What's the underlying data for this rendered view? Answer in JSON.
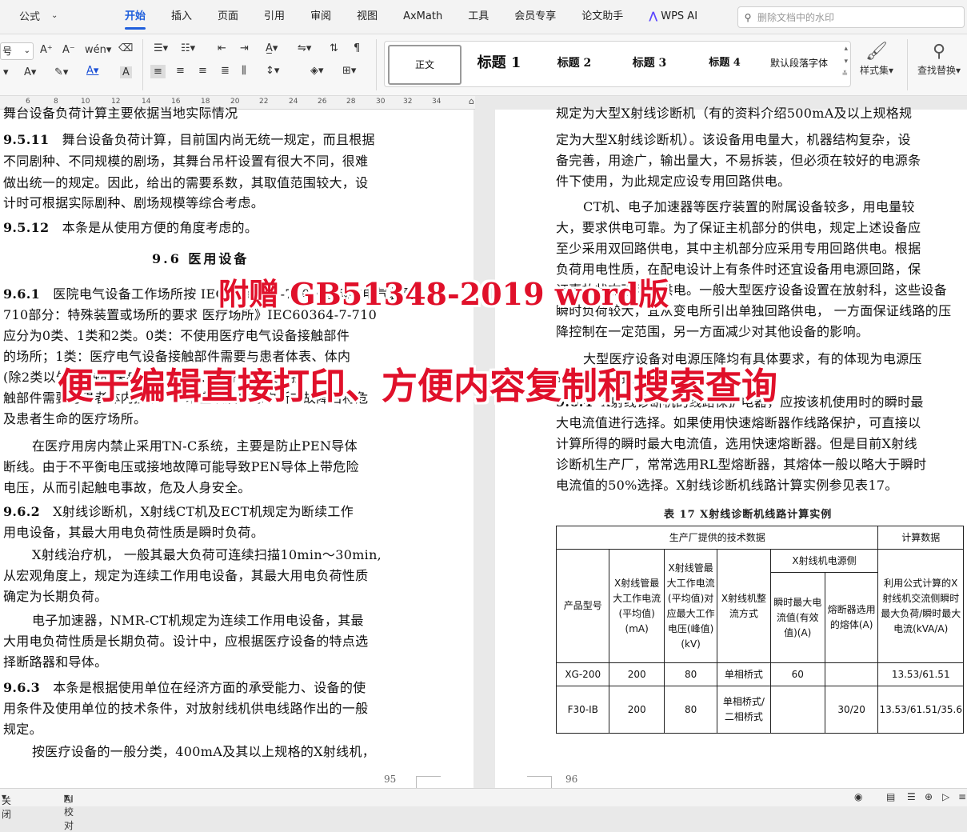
{
  "menubar": {
    "left_label": "公式",
    "tabs": [
      "开始",
      "插入",
      "页面",
      "引用",
      "审阅",
      "视图",
      "AxMath",
      "工具",
      "会员专享",
      "论文助手"
    ],
    "wps_ai": "WPS AI",
    "search_placeholder": "删除文档中的水印"
  },
  "ribbon": {
    "font_size": "号",
    "styles": [
      "正文",
      "标题 1",
      "标题 2",
      "标题 3",
      "标题 4",
      "默认段落字体"
    ],
    "styles_set": "样式集",
    "find_replace": "查找替换"
  },
  "ruler": [
    "6",
    "8",
    "10",
    "12",
    "14",
    "16",
    "18",
    "20",
    "22",
    "24",
    "26",
    "28",
    "30",
    "32",
    "34"
  ],
  "left_page": {
    "top_cut": "舞台设备负荷计算主要依据当地实际情况",
    "lines": [
      {
        "num": "9.5.11",
        "text": "舞台设备负荷计算，目前国内尚无统一规定，而且根据"
      },
      {
        "text": "不同剧种、不同规模的剧场，其舞台吊杆设置有很大不同，很难"
      },
      {
        "text": "做出统一的规定。因此，给出的需要系数，其取值范围较大，设"
      },
      {
        "text": "计时可根据实际剧种、剧场规模等综合考虑。"
      },
      {
        "num": "9.5.12",
        "text": "本条是从使用方便的角度考虑的。"
      }
    ],
    "heading": "9.6 医用设备",
    "lines2": [
      {
        "num": "9.6.1",
        "text": "医院电气设备工作场所按 IEC60364-7-710《建筑物电气装置"
      },
      {
        "text": "710部分：特殊装置或场所的要求 医疗场所》IEC60364-7-710"
      },
      {
        "text": "应分为0类、1类和2类。0类：不使用医疗电气设备接触部件"
      },
      {
        "text": "的场所；1类：医疗电气设备接触部件需要与患者体表、体内"
      },
      {
        "text": "(除2类以外)接触的医疗场所；2类：医疗电气设备接"
      },
      {
        "text": "触部件需要与患者体内接触，手术室以及电源中断或故障后将危"
      },
      {
        "text": "及患者生命的医疗场所。"
      },
      {
        "indent": true,
        "text": "在医疗用房内禁止采用TN-C系统，主要是防止PEN导体"
      },
      {
        "text": "断线。由于不平衡电压或接地故障可能导致PEN导体上带危险"
      },
      {
        "text": "电压，从而引起触电事故，危及人身安全。"
      },
      {
        "num": "9.6.2",
        "text": "X射线诊断机，X射线CT机及ECT机规定为断续工作"
      },
      {
        "text": "用电设备，其最大用电负荷性质是瞬时负荷。"
      },
      {
        "indent": true,
        "text": "X射线治疗机，  一般其最大负荷可连续扫描10min～30min,"
      },
      {
        "text": "从宏观角度上，规定为连续工作用电设备，其最大用电负荷性质"
      },
      {
        "text": "确定为长期负荷。"
      },
      {
        "indent": true,
        "text": "电子加速器，NMR-CT机规定为连续工作用电设备，其最"
      },
      {
        "text": "大用电负荷性质是长期负荷。设计中，应根据医疗设备的特点选"
      },
      {
        "text": "择断路器和导体。"
      },
      {
        "num": "9.6.3",
        "text": "本条是根据使用单位在经济方面的承受能力、设备的使"
      },
      {
        "text": "用条件及使用单位的技术条件，对放射线机供电线路作出的一般"
      },
      {
        "text": "规定。"
      },
      {
        "indent": true,
        "text": "按医疗设备的一般分类，400mA及其以上规格的X射线机，"
      }
    ],
    "page_number": "95"
  },
  "right_page": {
    "lines": [
      {
        "text": "规定为大型X射线诊断机（有的资料介绍500mA及以上规格规"
      },
      {
        "text": "定为大型X射线诊断机）。该设备用电量大，机器结构复杂，设"
      },
      {
        "text": "备完善，用途广，输出量大，不易拆装，但必须在较好的电源条"
      },
      {
        "text": "件下使用，为此规定应设专用回路供电。"
      },
      {
        "indent": true,
        "text": "CT机、电子加速器等医疗装置的附属设备较多，用电量较"
      },
      {
        "text": "大，要求供电可靠。为了保证主机部分的供电，规定上述设备应"
      },
      {
        "text": "至少采用双回路供电，其中主机部分应采用专用回路供电。根据"
      },
      {
        "text": "负荷用电性质，在配电设计上有条件时还宜设备用电源回路，保"
      },
      {
        "text": "证事故状态下可靠供电。一般大型医疗设备设置在放射科，这些设备"
      },
      {
        "text": "瞬时负荷较大，宜从变电所引出单独回路供电，  一方面保证线路的压"
      },
      {
        "text": "降控制在一定范围，另一方面减少对其他设备的影响。"
      },
      {
        "indent": true,
        "text": "大型医疗设备对电源压降均有具体要求，有的体现为电源压"
      },
      {
        "text": "降，有的体现为电源内阻。"
      },
      {
        "num": "9.6.4",
        "text": "X射线诊断机的线路保护电器，应按该机使用时的瞬时最"
      },
      {
        "text": "大电流值进行选择。如果使用快速熔断器作线路保护，可直接以"
      },
      {
        "text": "计算所得的瞬时最大电流值，选用快速熔断器。但是目前X射线"
      },
      {
        "text": "诊断机生产厂，常常选用RL型熔断器，其熔体一般以略大于瞬时"
      },
      {
        "text": "电流值的50%选择。X射线诊断机线路计算实例参见表17。"
      }
    ],
    "table_caption": "表 17  X射线诊断机线路计算实例",
    "table": {
      "group_header": "生产厂提供的技术数据",
      "calc_header": "计算数据",
      "col_model": "产品型号",
      "col_tube_current": "X射线管最大工作电流(平均值)(mA)",
      "col_tube_voltage": "X射线管最大工作电流(平均值)对应最大工作电压(峰值)(kV)",
      "col_rectify": "X射线机整流方式",
      "power_side": "X射线机电源侧",
      "col_inst_current": "瞬时最大电流值(有效值)(A)",
      "col_fuse": "熔断器选用的熔体(A)",
      "col_calc": "利用公式计算的X射线机交流侧瞬时最大负荷/瞬时最大电流(kVA/A)",
      "rows": [
        [
          "XG-200",
          "200",
          "80",
          "单相桥式",
          "60",
          "",
          "13.53/61.51"
        ],
        [
          "F30-IB",
          "200",
          "80",
          "单相桥式/二相桥式",
          "",
          "30/20",
          "13.53/61.51/35.6"
        ]
      ]
    },
    "page_number": "96"
  },
  "overlay": {
    "line1": "附赠 GB51348-2019 word版",
    "line2": "便于编辑直接打印、方便内容复制和搜索查询"
  },
  "statusbar": {
    "left": "关闭",
    "ai_proof": "AI 校对"
  }
}
